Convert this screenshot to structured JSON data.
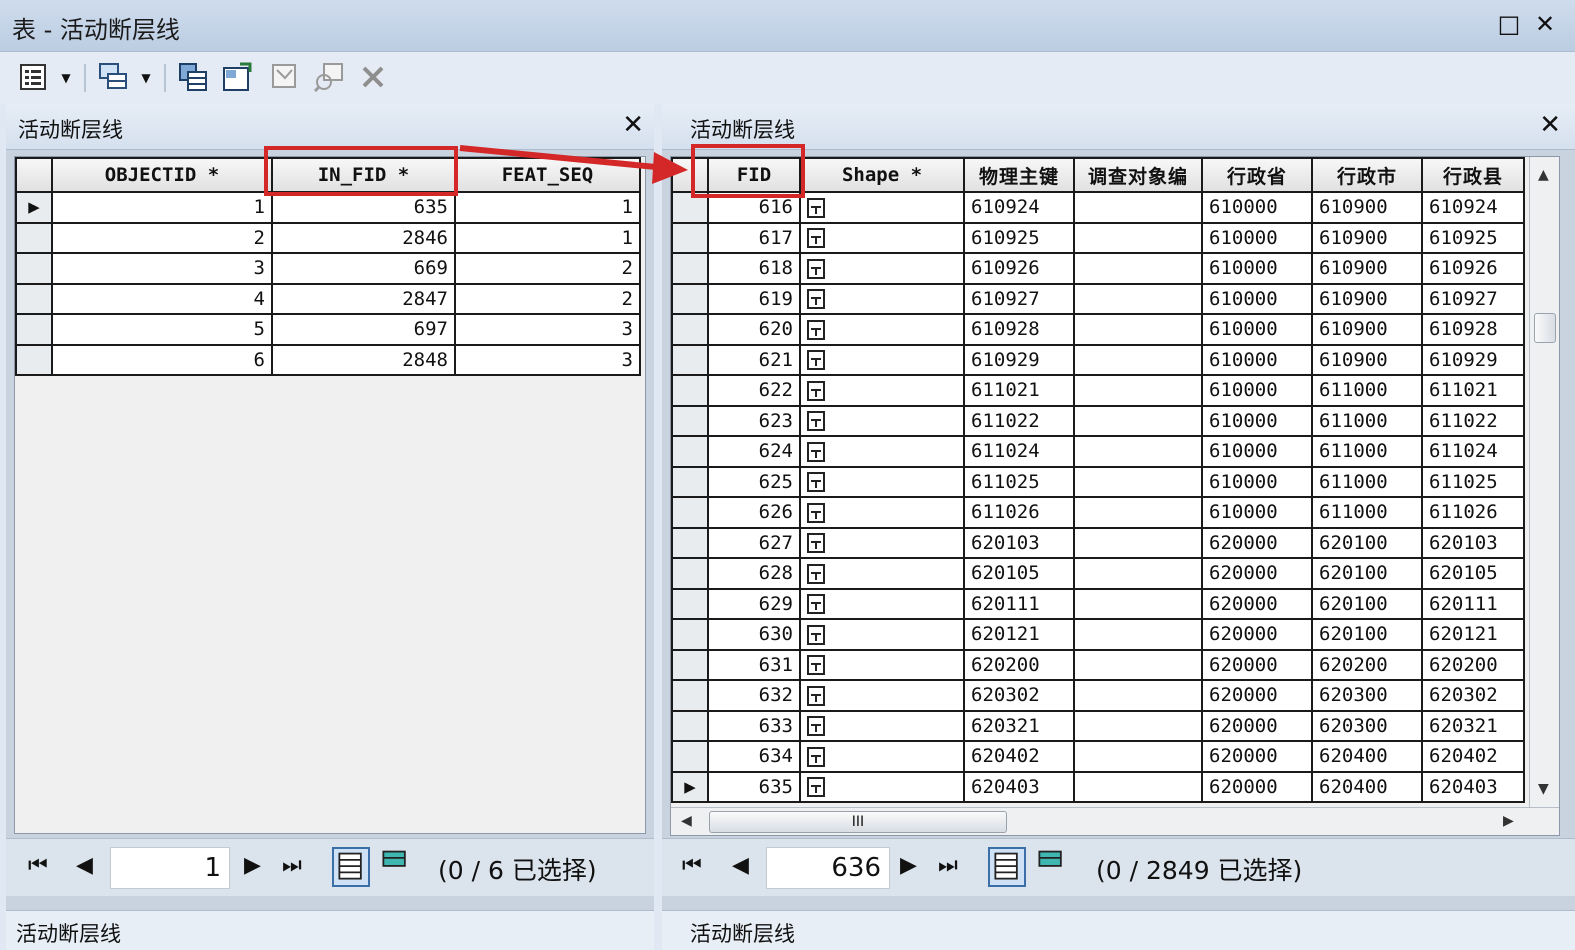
{
  "window": {
    "title": "表 - 活动断层线",
    "maximize_glyph": "□",
    "close_glyph": "✕"
  },
  "toolbar": {
    "icons": [
      "table-options-icon",
      "related-tables-icon",
      "select-by-attributes-icon",
      "switch-selection-icon",
      "clear-selection-icon",
      "zoom-to-selected-icon",
      "delete-selected-icon"
    ]
  },
  "left_table": {
    "title": "活动断层线",
    "columns": [
      "OBJECTID *",
      "IN_FID *",
      "FEAT_SEQ"
    ],
    "rows": [
      {
        "objectid": "1",
        "in_fid": "635",
        "feat_seq": "1"
      },
      {
        "objectid": "2",
        "in_fid": "2846",
        "feat_seq": "1"
      },
      {
        "objectid": "3",
        "in_fid": "669",
        "feat_seq": "2"
      },
      {
        "objectid": "4",
        "in_fid": "2847",
        "feat_seq": "2"
      },
      {
        "objectid": "5",
        "in_fid": "697",
        "feat_seq": "3"
      },
      {
        "objectid": "6",
        "in_fid": "2848",
        "feat_seq": "3"
      }
    ],
    "nav": {
      "current_record": "1",
      "selection_text": "(0 / 6 已选择)"
    },
    "status_tab": "活动断层线"
  },
  "right_table": {
    "title": "活动断层线",
    "columns": [
      "FID",
      "Shape *",
      "物理主键",
      "调查对象编",
      "行政省",
      "行政市",
      "行政县"
    ],
    "rows": [
      {
        "fid": "616",
        "shape": "面",
        "key": "610924",
        "survey": "",
        "prov": "610000",
        "city": "610900",
        "county": "610924"
      },
      {
        "fid": "617",
        "shape": "面",
        "key": "610925",
        "survey": "",
        "prov": "610000",
        "city": "610900",
        "county": "610925"
      },
      {
        "fid": "618",
        "shape": "面",
        "key": "610926",
        "survey": "",
        "prov": "610000",
        "city": "610900",
        "county": "610926"
      },
      {
        "fid": "619",
        "shape": "面",
        "key": "610927",
        "survey": "",
        "prov": "610000",
        "city": "610900",
        "county": "610927"
      },
      {
        "fid": "620",
        "shape": "面",
        "key": "610928",
        "survey": "",
        "prov": "610000",
        "city": "610900",
        "county": "610928"
      },
      {
        "fid": "621",
        "shape": "面",
        "key": "610929",
        "survey": "",
        "prov": "610000",
        "city": "610900",
        "county": "610929"
      },
      {
        "fid": "622",
        "shape": "面",
        "key": "611021",
        "survey": "",
        "prov": "610000",
        "city": "611000",
        "county": "611021"
      },
      {
        "fid": "623",
        "shape": "面",
        "key": "611022",
        "survey": "",
        "prov": "610000",
        "city": "611000",
        "county": "611022"
      },
      {
        "fid": "624",
        "shape": "面",
        "key": "611024",
        "survey": "",
        "prov": "610000",
        "city": "611000",
        "county": "611024"
      },
      {
        "fid": "625",
        "shape": "面",
        "key": "611025",
        "survey": "",
        "prov": "610000",
        "city": "611000",
        "county": "611025"
      },
      {
        "fid": "626",
        "shape": "面",
        "key": "611026",
        "survey": "",
        "prov": "610000",
        "city": "611000",
        "county": "611026"
      },
      {
        "fid": "627",
        "shape": "面",
        "key": "620103",
        "survey": "",
        "prov": "620000",
        "city": "620100",
        "county": "620103"
      },
      {
        "fid": "628",
        "shape": "面",
        "key": "620105",
        "survey": "",
        "prov": "620000",
        "city": "620100",
        "county": "620105"
      },
      {
        "fid": "629",
        "shape": "面",
        "key": "620111",
        "survey": "",
        "prov": "620000",
        "city": "620100",
        "county": "620111"
      },
      {
        "fid": "630",
        "shape": "面",
        "key": "620121",
        "survey": "",
        "prov": "620000",
        "city": "620100",
        "county": "620121"
      },
      {
        "fid": "631",
        "shape": "面",
        "key": "620200",
        "survey": "",
        "prov": "620000",
        "city": "620200",
        "county": "620200"
      },
      {
        "fid": "632",
        "shape": "面",
        "key": "620302",
        "survey": "",
        "prov": "620000",
        "city": "620300",
        "county": "620302"
      },
      {
        "fid": "633",
        "shape": "面",
        "key": "620321",
        "survey": "",
        "prov": "620000",
        "city": "620300",
        "county": "620321"
      },
      {
        "fid": "634",
        "shape": "面",
        "key": "620402",
        "survey": "",
        "prov": "620000",
        "city": "620400",
        "county": "620402"
      },
      {
        "fid": "635",
        "shape": "面",
        "key": "620403",
        "survey": "",
        "prov": "620000",
        "city": "620400",
        "county": "620403"
      }
    ],
    "active_row_index": 19,
    "hscroll_thumb_text": "III",
    "nav": {
      "current_record": "636",
      "selection_text": "(0 / 2849 已选择)"
    },
    "status_tab": "活动断层线"
  },
  "colors": {
    "highlight": "#d42828",
    "title_bar": "#c4d4e8"
  }
}
